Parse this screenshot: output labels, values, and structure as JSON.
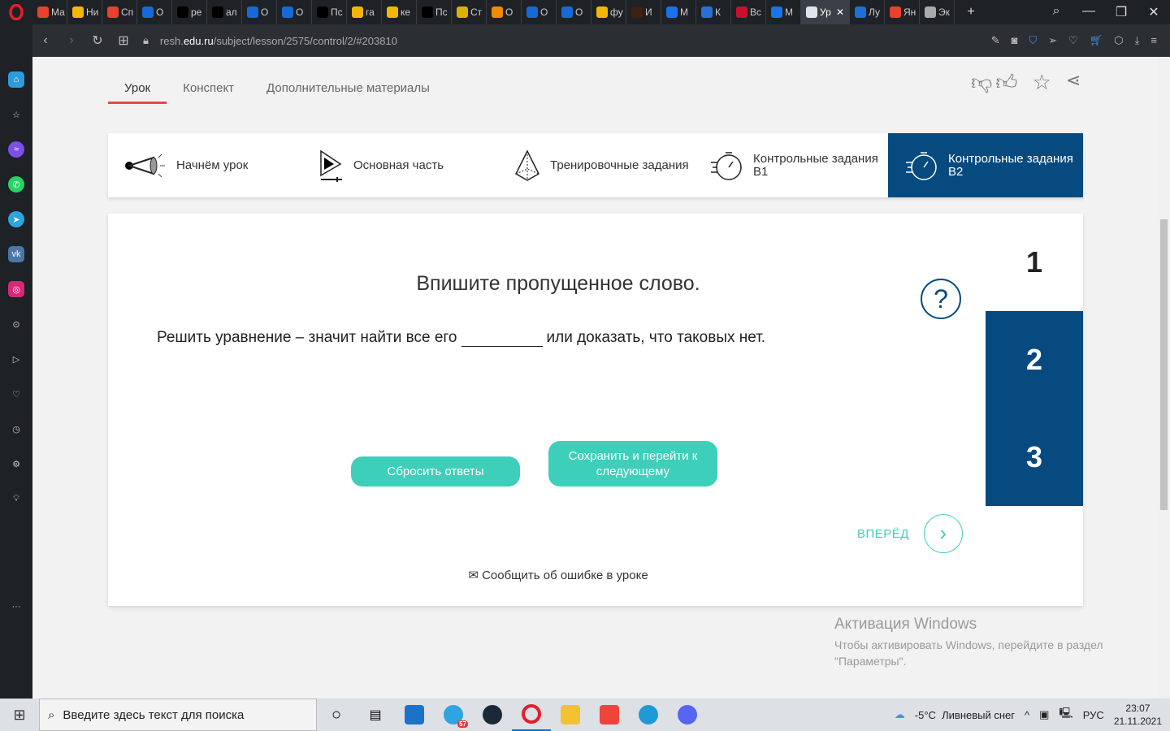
{
  "browser": {
    "tabs": [
      {
        "label": "Ма",
        "icon": "yandex",
        "color": "#e8412c"
      },
      {
        "label": "Ни",
        "icon": "image",
        "color": "#f2b705"
      },
      {
        "label": "Сп",
        "icon": "yandex",
        "color": "#e8412c"
      },
      {
        "label": "О",
        "icon": "question",
        "color": "#1769d6"
      },
      {
        "label": "ре",
        "icon": "3",
        "color": "#000"
      },
      {
        "label": "ал",
        "icon": "3",
        "color": "#000"
      },
      {
        "label": "О",
        "icon": "question",
        "color": "#1769d6"
      },
      {
        "label": "О",
        "icon": "question",
        "color": "#1769d6"
      },
      {
        "label": "Пс",
        "icon": "3",
        "color": "#000"
      },
      {
        "label": "га",
        "icon": "image",
        "color": "#f2b705"
      },
      {
        "label": "ке",
        "icon": "image",
        "color": "#f2b705"
      },
      {
        "label": "Пс",
        "icon": "3",
        "color": "#000"
      },
      {
        "label": "Ст",
        "icon": "coin",
        "color": "#d9b300"
      },
      {
        "label": "О",
        "icon": "DNS",
        "color": "#f08a00"
      },
      {
        "label": "О",
        "icon": "question",
        "color": "#1769d6"
      },
      {
        "label": "О",
        "icon": "question",
        "color": "#1769d6"
      },
      {
        "label": "фу",
        "icon": "image",
        "color": "#f2b705"
      },
      {
        "label": "И",
        "icon": "brand",
        "color": "#402010"
      },
      {
        "label": "М",
        "icon": "chat",
        "color": "#1a73e8"
      },
      {
        "label": "К",
        "icon": "VK",
        "color": "#2a6fd6"
      },
      {
        "label": "Вс",
        "icon": "ГТО",
        "color": "#c8102e"
      },
      {
        "label": "М",
        "icon": "chat",
        "color": "#1a73e8"
      },
      {
        "label": "Ур",
        "icon": "resh",
        "color": "#dfe5ee",
        "active": true
      },
      {
        "label": "Лу",
        "icon": "edge",
        "color": "#1e6fd9"
      },
      {
        "label": "Ян",
        "icon": "translate",
        "color": "#e8412c"
      },
      {
        "label": "Эк",
        "icon": "grid",
        "color": "#aaa"
      }
    ],
    "url_prefix": "resh.",
    "url_domain": "edu.ru",
    "url_path": "/subject/lesson/2575/control/2/#203810"
  },
  "page": {
    "tabs": [
      "Урок",
      "Конспект",
      "Дополнительные материалы"
    ],
    "steps": [
      "Начнём урок",
      "Основная часть",
      "Тренировочные задания",
      "Контрольные задания В1",
      "Контрольные задания В2"
    ],
    "question_title": "Впишите пропущенное слово.",
    "question_before": "Решить уравнение – значит найти все его",
    "question_after": "или доказать, что таковых нет.",
    "help": "?",
    "numbers": [
      "1",
      "2",
      "3"
    ],
    "reset": "Сбросить ответы",
    "save": "Сохранить и перейти к следующему",
    "forward": "ВПЕРЁД",
    "report": "Сообщить об ошибке в уроке",
    "accent": "#3ecfba",
    "brand": "#074a7f"
  },
  "watermark": {
    "title": "Активация Windows",
    "text": "Чтобы активировать Windows, перейдите в раздел \"Параметры\"."
  },
  "taskbar": {
    "search_placeholder": "Введите здесь текст для поиска",
    "badge": "57",
    "weather": "-5°C  Ливневый снег",
    "lang": "РУС",
    "time": "23:07",
    "date": "21.11.2021"
  }
}
